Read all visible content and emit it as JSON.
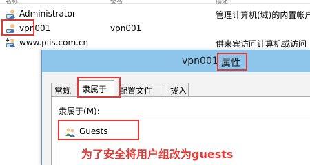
{
  "list": {
    "columns": [
      "名称",
      "全名",
      "描述"
    ],
    "rows": [
      {
        "name": "Administrator",
        "fullname": "",
        "description": "管理计算机(域)的内置帐户",
        "icon": "user-icon"
      },
      {
        "name": "vpn001",
        "fullname": "vpn001",
        "description": "",
        "icon": "user-icon"
      },
      {
        "name": "www.piis.com.cn",
        "fullname": "",
        "description": "供来宾访问计算机或访问",
        "icon": "user-download-icon"
      }
    ]
  },
  "dialog": {
    "title_name": "vpn001",
    "title_suffix": "属性",
    "tabs": [
      "常规",
      "隶属于",
      "配置文件",
      "拨入"
    ],
    "active_tab": "隶属于",
    "member_of_label": "隶属于(M):",
    "groups": [
      {
        "name": "Guests",
        "icon": "group-icon"
      }
    ]
  },
  "annotation": {
    "text": "为了安全将用户组改为guests",
    "color": "#e53935"
  },
  "colors": {
    "highlight": "#e53935",
    "titlebar": "#8ec6eb"
  }
}
